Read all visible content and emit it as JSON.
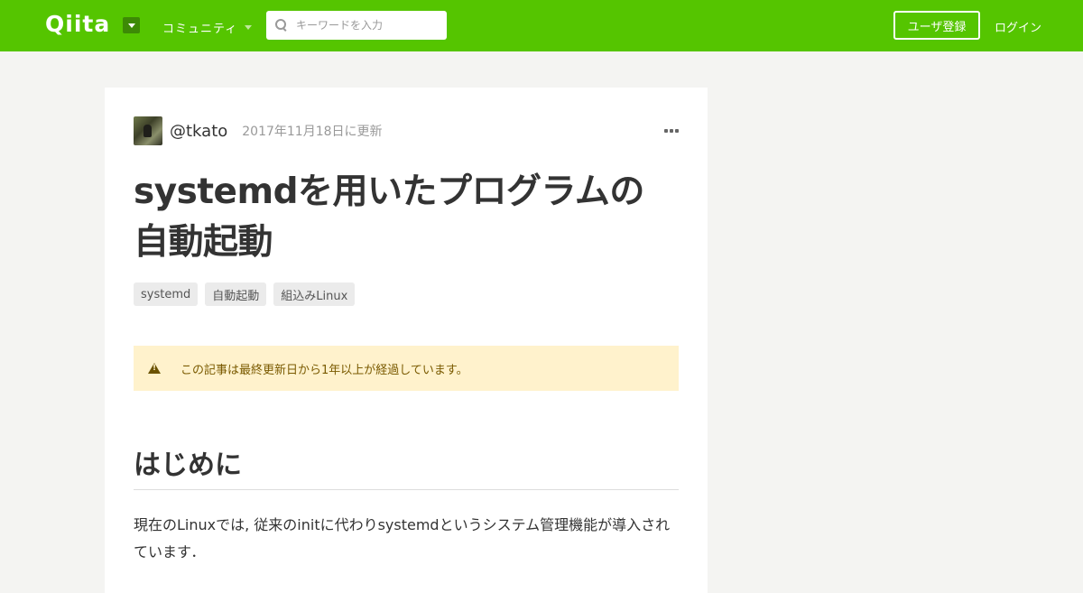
{
  "header": {
    "logo": "Qiita",
    "community_label": "コミュニティ",
    "search_placeholder": "キーワードを入力",
    "signup_label": "ユーザ登録",
    "login_label": "ログイン",
    "brand_color": "#55c500"
  },
  "article": {
    "author": "@tkato",
    "updated": "2017年11月18日に更新",
    "title": "systemdを用いたプログラムの自動起動",
    "tags": [
      "systemd",
      "自動起動",
      "組込みLinux"
    ],
    "notice": "この記事は最終更新日から1年以上が経過しています。",
    "section_heading": "はじめに",
    "paragraph": "現在のLinuxでは, 従来のinitに代わりsystemdというシステム管理機能が導入されています．"
  }
}
